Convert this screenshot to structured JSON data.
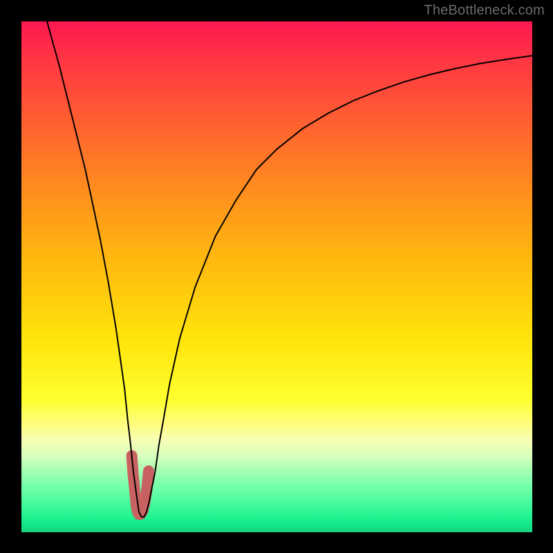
{
  "watermark": "TheBottleneck.com",
  "chart_data": {
    "type": "line",
    "title": "",
    "xlabel": "",
    "ylabel": "",
    "xlim": [
      0,
      100
    ],
    "ylim": [
      0,
      100
    ],
    "legend": false,
    "grid": false,
    "background": "vertical-gradient red→orange→yellow→green (top→bottom)",
    "series": [
      {
        "name": "bottleneck-curve",
        "color": "#000000",
        "x": [
          5,
          7.5,
          10,
          12.5,
          14,
          15.5,
          17,
          18.5,
          19.5,
          20.2,
          20.8,
          21.4,
          21.9,
          22.3,
          22.7,
          23.0,
          23.5,
          24.0,
          24.5,
          25.0,
          25.6,
          26.2,
          26.9,
          27.8,
          29,
          31,
          34,
          38,
          42,
          46,
          50,
          55,
          60,
          65,
          70,
          75,
          80,
          85,
          90,
          95,
          100
        ],
        "y": [
          100,
          91,
          81,
          71,
          64,
          57,
          49,
          40,
          33,
          28,
          22,
          17,
          12,
          9,
          6,
          4,
          3,
          3,
          4,
          6,
          9,
          12,
          17,
          22,
          29,
          38,
          48,
          58,
          65,
          71,
          75,
          79,
          82,
          84.5,
          86.5,
          88.2,
          89.6,
          90.8,
          91.8,
          92.6,
          93.3
        ]
      },
      {
        "name": "highlight-band",
        "color": "#c86161",
        "type": "thick-marker",
        "x": [
          21.6,
          21.9,
          22.2,
          22.5,
          22.7,
          23.0,
          23.3,
          23.7,
          24.1,
          24.5,
          24.9
        ],
        "y": [
          15,
          11,
          8,
          5,
          4,
          3.5,
          3.5,
          4,
          5.5,
          8,
          12
        ]
      }
    ]
  }
}
